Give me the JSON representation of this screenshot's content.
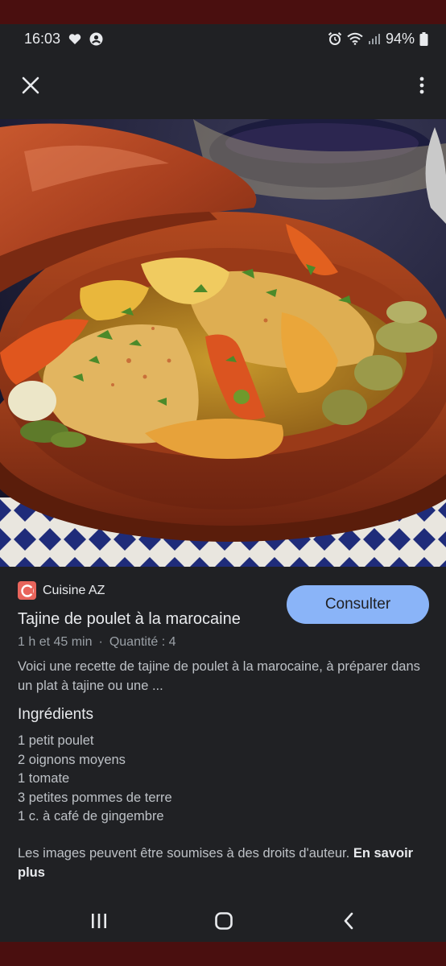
{
  "status_bar": {
    "time": "16:03",
    "battery": "94%",
    "icons": [
      "heart-icon",
      "account-icon",
      "alarm-icon",
      "wifi-icon",
      "signal-icon",
      "battery-icon"
    ]
  },
  "top_bar": {
    "close_icon": "close-icon",
    "more_icon": "more-vertical-icon"
  },
  "result": {
    "source_name": "Cuisine AZ",
    "action_label": "Consulter",
    "title": "Tajine de poulet à la marocaine",
    "duration": "1 h et 45 min",
    "separator": "·",
    "quantity": "Quantité : 4",
    "description": "Voici une recette de tajine de poulet à la marocaine, à préparer dans un plat à tajine ou une ...",
    "ingredients_title": "Ingrédients",
    "ingredients": [
      "1 petit poulet",
      "2 oignons moyens",
      "1 tomate",
      "3 petites pommes de terre",
      "1 c. à café de gingembre"
    ],
    "copyright_text": "Les images peuvent être soumises à des droits d'auteur.",
    "learn_more": "En savoir plus"
  },
  "nav_bar": {
    "icons": [
      "recent-apps-icon",
      "home-icon",
      "back-icon"
    ]
  },
  "colors": {
    "background": "#202124",
    "accent_button": "#8ab4f8",
    "source_logo": "#e8655c",
    "edge": "#4a0f0f"
  }
}
